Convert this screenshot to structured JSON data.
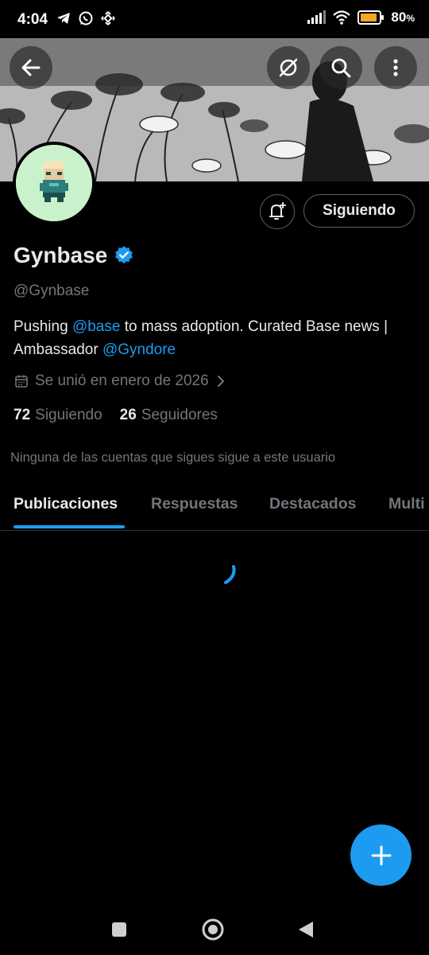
{
  "status_bar": {
    "time": "4:04",
    "battery": "80",
    "battery_suffix": "%",
    "left_icons": [
      "telegram-icon",
      "whatsapp-icon",
      "binance-icon"
    ],
    "right_icons": [
      "signal-icon",
      "wifi-icon",
      "battery-icon"
    ]
  },
  "header": {
    "back_icon": "arrow-left-icon",
    "actions": [
      "grok-icon",
      "search-icon",
      "more-vertical-icon"
    ]
  },
  "profile": {
    "name": "Gynbase",
    "verified": true,
    "handle": "@Gynbase",
    "bio": {
      "part1": "Pushing ",
      "mention1": "@base",
      "part2": " to mass adoption.  Curated Base news | Ambassador ",
      "mention2": "@Gyndore"
    },
    "joined": "Se unió en enero de 2026",
    "following_count": "72",
    "following_label": "Siguiendo",
    "followers_count": "26",
    "followers_label": "Seguidores",
    "mutual_note": "Ninguna de las cuentas que sigues sigue a este usuario"
  },
  "actions": {
    "follow_button": "Siguiendo",
    "notify_icon": "bell-plus-icon"
  },
  "tabs": [
    {
      "label": "Publicaciones",
      "active": true
    },
    {
      "label": "Respuestas",
      "active": false
    },
    {
      "label": "Destacados",
      "active": false
    },
    {
      "label": "Multi",
      "active": false
    }
  ],
  "colors": {
    "accent": "#1d9bf0",
    "background": "#000000",
    "text_primary": "#e7e9ea",
    "text_secondary": "#71767b",
    "avatar_bg": "#c9f2cc"
  },
  "fab_icon": "plus-icon",
  "nav_bar": [
    "square-icon",
    "home-circle-icon",
    "back-triangle-icon"
  ]
}
